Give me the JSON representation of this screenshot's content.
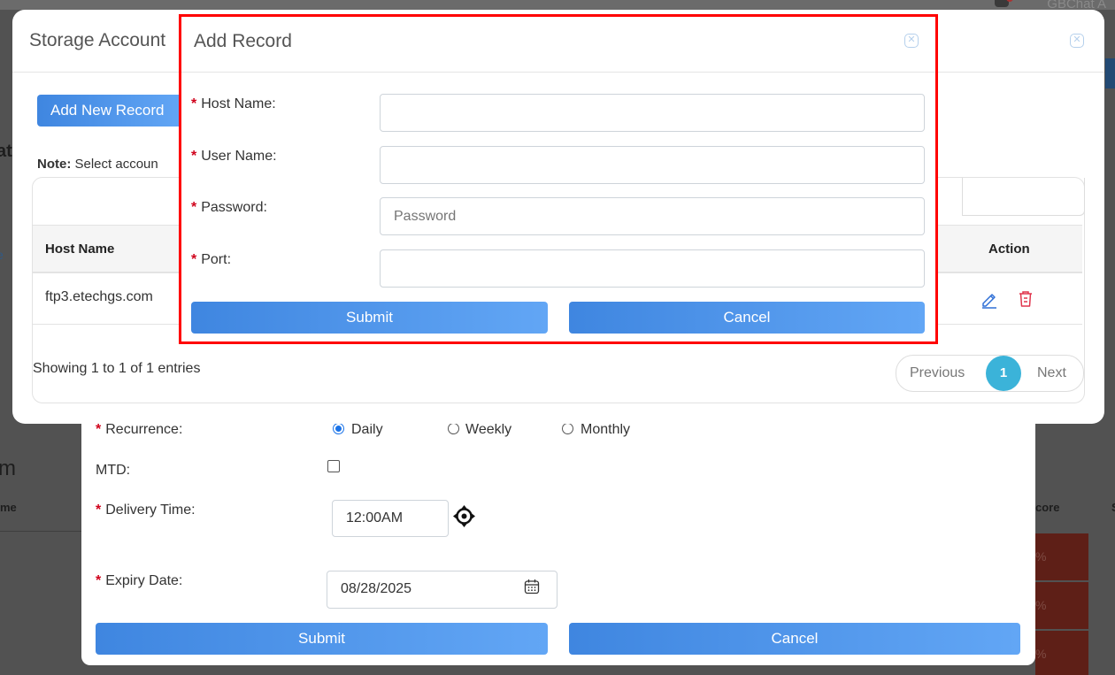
{
  "background": {
    "topbar_text": "GBChat A",
    "heading_fragment": "m",
    "left_fragment_1": "at",
    "left_fragment_2": "e",
    "col_left_fragment": "me",
    "col_right_fragment": "core",
    "col_right_fragment_2": "S",
    "red_cells": [
      "%",
      "%",
      "%"
    ]
  },
  "schedule_form": {
    "recurrence_label": "Recurrence:",
    "recurrence_options": [
      "Daily",
      "Weekly",
      "Monthly"
    ],
    "recurrence_selected": "Daily",
    "mtd_label": "MTD:",
    "mtd_checked": false,
    "delivery_time_label": "Delivery Time:",
    "delivery_time_value": "12:00AM",
    "expiry_date_label": "Expiry Date:",
    "expiry_date_value": "08/28/2025",
    "submit_label": "Submit",
    "cancel_label": "Cancel"
  },
  "storage_modal": {
    "title": "Storage Account",
    "add_new_label": "Add New Record",
    "note_bold": "Note:",
    "note_text": "Select accoun",
    "columns": {
      "host_name": "Host Name",
      "action": "Action"
    },
    "rows": [
      {
        "host_name": "ftp3.etechgs.com"
      }
    ],
    "showing_text": "Showing 1 to 1 of 1 entries",
    "pagination": {
      "previous": "Previous",
      "current": "1",
      "next": "Next"
    }
  },
  "add_record_modal": {
    "title": "Add Record",
    "fields": {
      "host_name": {
        "label": "Host Name:",
        "value": "",
        "placeholder": ""
      },
      "user_name": {
        "label": "User Name:",
        "value": "",
        "placeholder": ""
      },
      "password": {
        "label": "Password:",
        "value": "",
        "placeholder": "Password"
      },
      "port": {
        "label": "Port:",
        "value": "",
        "placeholder": ""
      }
    },
    "required_mark": "*",
    "submit_label": "Submit",
    "cancel_label": "Cancel"
  },
  "colors": {
    "accent": "#3f86e0",
    "required": "#d0021b",
    "highlight_border": "#ff0000",
    "pagination_active": "#3bb3d9",
    "delete_icon": "#e0354d"
  }
}
